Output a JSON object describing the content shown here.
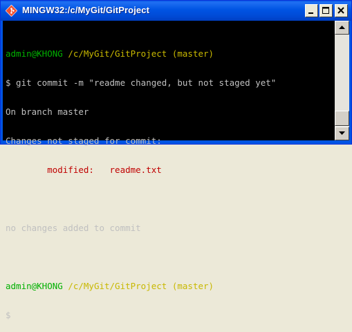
{
  "window": {
    "title": "MINGW32:/c/MyGit/GitProject",
    "app_icon": "git-diamond-icon",
    "buttons": {
      "minimize": "minimize-icon",
      "maximize": "maximize-icon",
      "close": "close-icon"
    }
  },
  "terminal": {
    "prompt1": {
      "user": "admin@KHONG",
      "path": " /c/MyGit/GitProject (master)"
    },
    "command": "$ git commit -m \"readme changed, but not staged yet\"",
    "out_branch": "On branch master",
    "out_changes": "Changes not staged for commit:",
    "modified": {
      "label": "        modified:   ",
      "file": "readme.txt"
    },
    "blank": "",
    "out_nochanges": "no changes added to commit",
    "prompt2": {
      "user": "admin@KHONG",
      "path": " /c/MyGit/GitProject (master)"
    },
    "cursor_prompt": "$"
  },
  "colors": {
    "prompt_user": "#00b000",
    "prompt_path": "#c8b800",
    "modified": "#c00000",
    "text": "#c0c0c0",
    "background": "#000000"
  }
}
